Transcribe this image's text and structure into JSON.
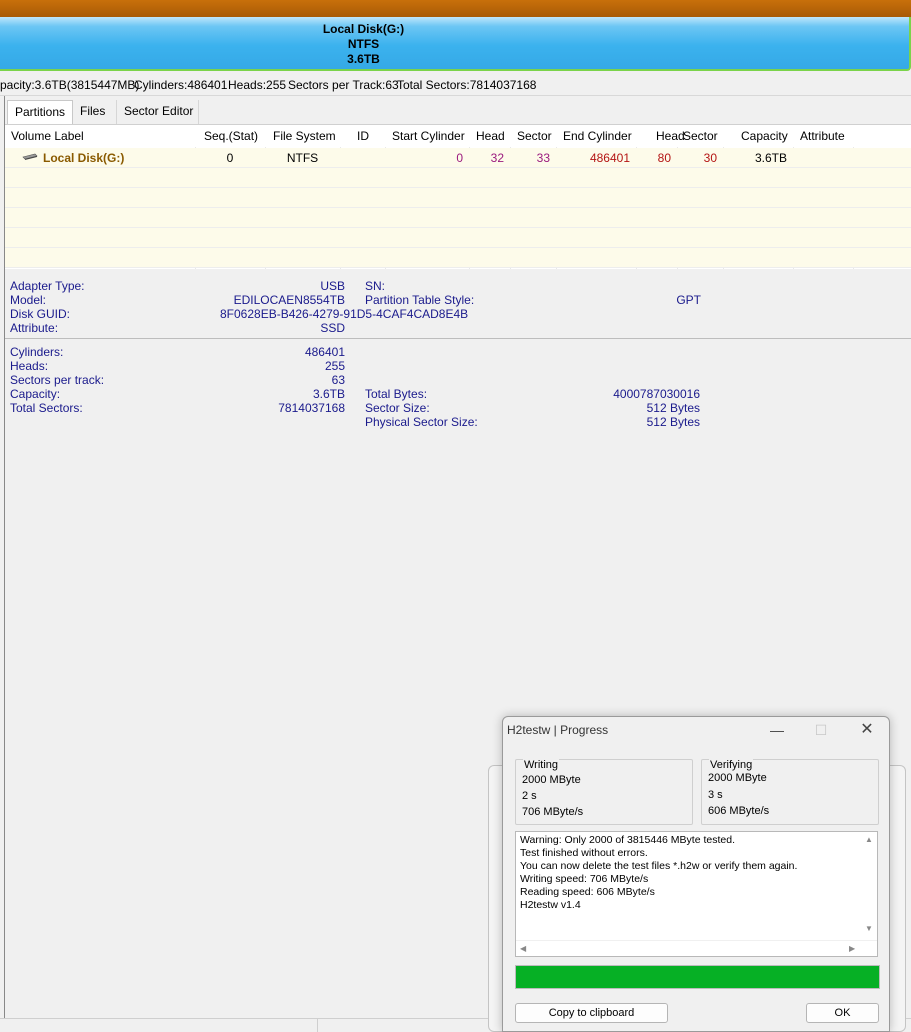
{
  "disk_banner": {
    "name": "Local Disk(G:)",
    "fs": "NTFS",
    "size": "3.6TB"
  },
  "info_bar": {
    "capacity": "pacity:3.6TB(3815447MB)",
    "cylinders": "Cylinders:486401",
    "heads": "Heads:255",
    "sectors_per_track": "Sectors per Track:63",
    "total_sectors": "Total Sectors:7814037168"
  },
  "tabs": [
    "Partitions",
    "Files",
    "Sector Editor"
  ],
  "table": {
    "headers": [
      "Volume Label",
      "Seq.(Stat)",
      "File System",
      "ID",
      "Start Cylinder",
      "Head",
      "Sector",
      "End Cylinder",
      "Head",
      "Sector",
      "Capacity",
      "Attribute"
    ],
    "row": {
      "volume_label": "Local Disk(G:)",
      "seq": "0",
      "fs": "NTFS",
      "id": "",
      "start_cyl": "0",
      "start_head": "32",
      "start_sector": "33",
      "end_cyl": "486401",
      "end_head": "80",
      "end_sector": "30",
      "capacity": "3.6TB",
      "attribute": ""
    }
  },
  "details": {
    "adapter_label": "Adapter Type:",
    "adapter_value": "USB",
    "sn_label": "SN:",
    "model_label": "Model:",
    "model_value": "EDILOCAEN8554TB",
    "pts_label": "Partition Table Style:",
    "pts_value": "GPT",
    "guid_label": "Disk GUID:",
    "guid_value": "8F0628EB-B426-4279-91D5-4CAF4CAD8E4B",
    "attr_label": "Attribute:",
    "attr_value": "SSD",
    "cyl_label": "Cylinders:",
    "cyl_value": "486401",
    "heads_label": "Heads:",
    "heads_value": "255",
    "spt_label": "Sectors per track:",
    "spt_value": "63",
    "cap_label": "Capacity:",
    "cap_value": "3.6TB",
    "ts_label": "Total Sectors:",
    "ts_value": "7814037168",
    "tb_label": "Total Bytes:",
    "tb_value": "4000787030016",
    "ss_label": "Sector Size:",
    "ss_value": "512 Bytes",
    "pss_label": "Physical Sector Size:",
    "pss_value": "512 Bytes"
  },
  "dialog": {
    "title": "H2testw | Progress",
    "writing": {
      "title": "Writing",
      "amount": "2000 MByte",
      "time": "2 s",
      "speed": "706 MByte/s"
    },
    "verifying": {
      "title": "Verifying",
      "amount": "2000 MByte",
      "time": "3 s",
      "speed": "606 MByte/s"
    },
    "log": [
      "Warning: Only 2000 of 3815446 MByte tested.",
      "Test finished without errors.",
      "You can now delete the test files *.h2w or verify them again.",
      "Writing speed: 706 MByte/s",
      "Reading speed: 606 MByte/s",
      "H2testw v1.4"
    ],
    "progress": 1.0,
    "progress_color": "#06b025",
    "copy_label": "Copy to clipboard",
    "ok_label": "OK"
  }
}
